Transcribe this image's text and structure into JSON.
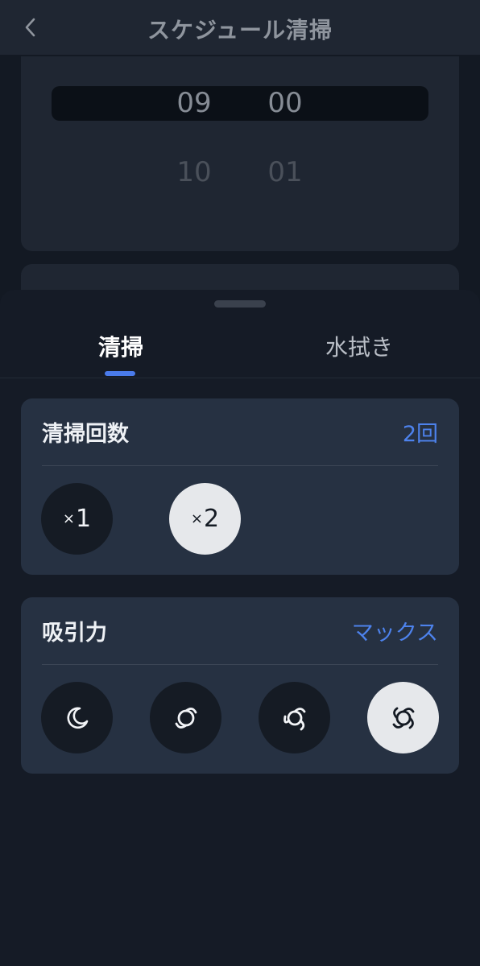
{
  "header": {
    "title": "スケジュール清掃",
    "back_icon": "chevron-left-icon"
  },
  "time_picker": {
    "selected_hour": "09",
    "selected_minute": "00",
    "next_hour": "10",
    "next_minute": "01"
  },
  "tabs": [
    {
      "label": "清掃",
      "active": true
    },
    {
      "label": "水拭き",
      "active": false
    }
  ],
  "clean_count": {
    "title": "清掃回数",
    "value": "2回",
    "options": [
      {
        "label": "1",
        "selected": false
      },
      {
        "label": "2",
        "selected": true
      }
    ]
  },
  "suction": {
    "title": "吸引力",
    "value": "マックス",
    "options": [
      {
        "icon": "moon-icon",
        "selected": false
      },
      {
        "icon": "fan-standard-icon",
        "selected": false
      },
      {
        "icon": "fan-strong-icon",
        "selected": false
      },
      {
        "icon": "fan-max-icon",
        "selected": true
      }
    ]
  },
  "colors": {
    "accent": "#4d82ec",
    "sheet_bg": "#151b26",
    "card_bg": "#263142",
    "selected_bg": "#e6e8eb"
  }
}
